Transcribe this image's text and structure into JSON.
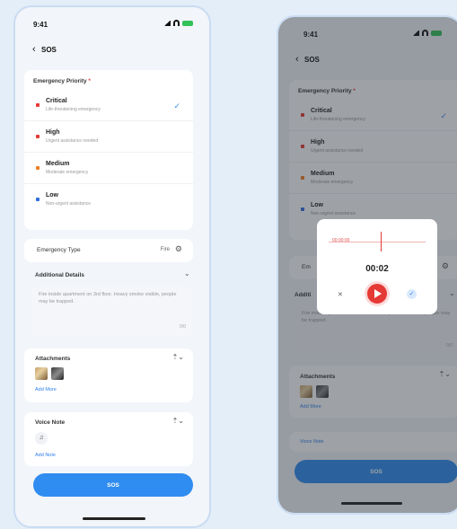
{
  "left": {
    "status_time": "9:41",
    "nav_title": "SOS",
    "priority_label": "Emergency Priority",
    "required_mark": "*",
    "priorities": [
      {
        "name": "Critical",
        "desc": "Life-threatening emergency",
        "color": "#e53935",
        "selected": true
      },
      {
        "name": "High",
        "desc": "Urgent assistance needed",
        "color": "#e53935",
        "selected": false
      },
      {
        "name": "Medium",
        "desc": "Moderate emergency",
        "color": "#f07c1e",
        "selected": false
      },
      {
        "name": "Low",
        "desc": "Non-urgent assistance",
        "color": "#2f6fe0",
        "selected": false
      }
    ],
    "type_label": "Emergency Type",
    "type_value": "Fire",
    "details_label": "Additional Details",
    "details_text": "Fire inside apartment on 3rd floor. Heavy smoke visible, people may be trapped.",
    "details_counter": "0/0",
    "media_label": "Attachments",
    "media_add": "Add More",
    "voice_label": "Voice Note",
    "voice_add": "Add Note",
    "submit": "SOS"
  },
  "right": {
    "status_time": "9:41",
    "nav_title": "SOS",
    "priority_label": "Emergency Priority",
    "priorities": [
      {
        "name": "Critical",
        "desc": "Life-threatening emergency",
        "color": "#e53935"
      },
      {
        "name": "High",
        "desc": "Urgent assistance needed",
        "color": "#e53935"
      },
      {
        "name": "Medium",
        "desc": "Moderate emergency",
        "color": "#f07c1e"
      },
      {
        "name": "Low",
        "desc": "Non-urgent assistance",
        "color": "#2f6fe0"
      }
    ],
    "type_label": "Em",
    "details_label": "Additi",
    "details_text": "Fire inside apartment on 3rd floor. Heavy smoke visible, people may be trapped.",
    "details_counter": "0/0",
    "media_label": "Attachments",
    "media_add": "Add More",
    "voice_add": "Voice Note",
    "submit": "SOS",
    "recorder": {
      "wave_text": "00:00:00",
      "time": "00:02",
      "close_icon": "x-icon",
      "confirm_icon": "check-icon"
    }
  },
  "colors": {
    "accent": "#2f8cf0",
    "critical": "#e53935",
    "medium": "#f07c1e",
    "low": "#2f6fe0"
  }
}
